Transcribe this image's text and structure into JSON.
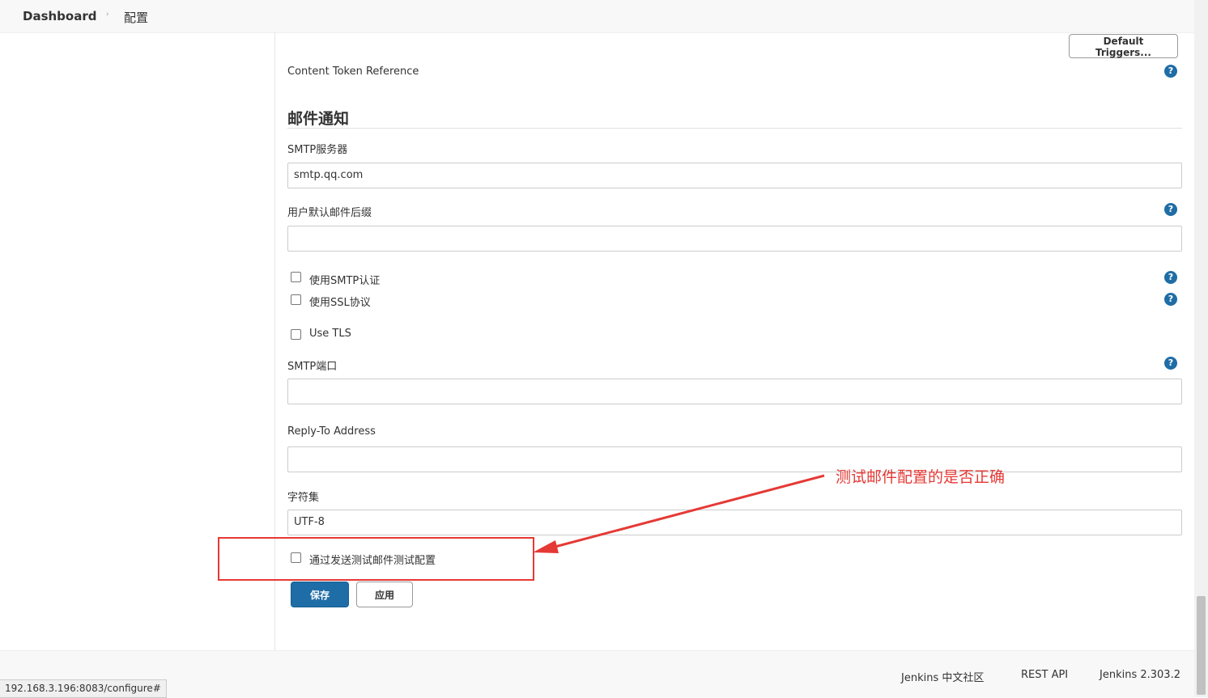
{
  "breadcrumb": {
    "home": "Dashboard",
    "separator": "›",
    "current": "配置"
  },
  "top": {
    "default_triggers_label": "Default Triggers...",
    "content_token_label": "Content Token Reference"
  },
  "mail_section": {
    "title": "邮件通知",
    "smtp_server_label": "SMTP服务器",
    "smtp_server_value": "smtp.qq.com",
    "default_suffix_label": "用户默认邮件后缀",
    "default_suffix_value": "",
    "use_smtp_auth_label": "使用SMTP认证",
    "use_ssl_label": "使用SSL协议",
    "use_tls_label": "Use TLS",
    "smtp_port_label": "SMTP端口",
    "smtp_port_value": "",
    "reply_to_label": "Reply-To Address",
    "reply_to_value": "",
    "charset_label": "字符集",
    "charset_value": "UTF-8",
    "test_config_label": "通过发送测试邮件测试配置"
  },
  "actions": {
    "save_label": "保存",
    "apply_label": "应用"
  },
  "help_glyph": "?",
  "annotation": {
    "text": "测试邮件配置的是否正确",
    "color": "#e53935"
  },
  "footer": {
    "community": "Jenkins 中文社区",
    "rest_api": "REST API",
    "version": "Jenkins 2.303.2"
  },
  "status_bar": {
    "url": "192.168.3.196:8083/configure#"
  },
  "colors": {
    "primary": "#1f6da6",
    "annotation": "#e53935"
  }
}
